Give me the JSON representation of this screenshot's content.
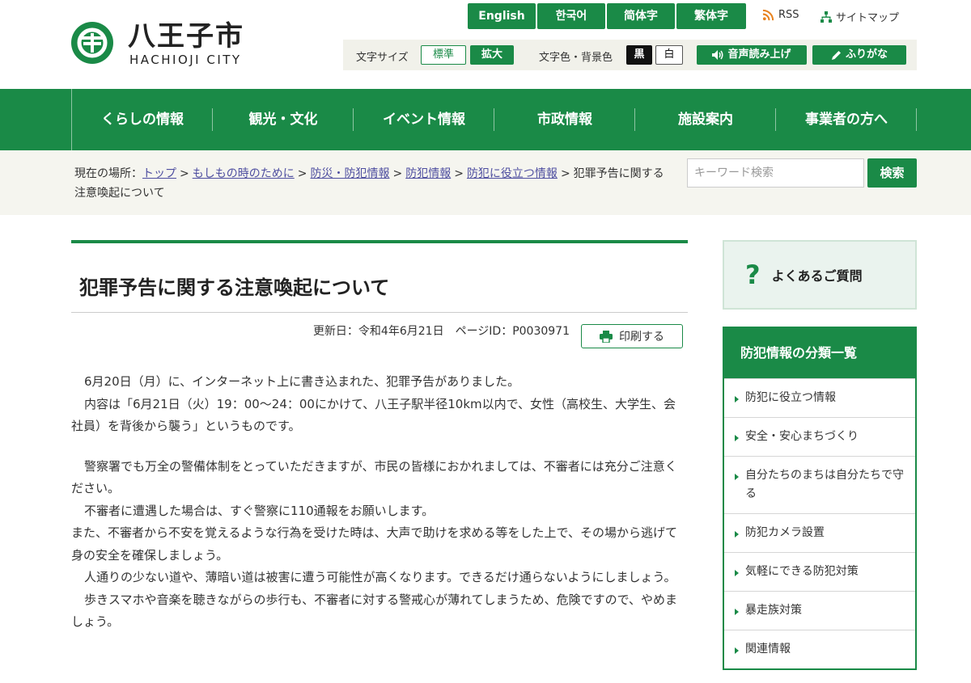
{
  "header": {
    "logo_jp": "八王子市",
    "logo_en": "HACHIOJI CITY",
    "languages": [
      "English",
      "한국어",
      "简体字",
      "繁体字"
    ],
    "rss": "RSS",
    "sitemap": "サイトマップ",
    "font_size_label": "文字サイズ",
    "font_standard": "標準",
    "font_large": "拡大",
    "color_label": "文字色・背景色",
    "color_black": "黒",
    "color_white": "白",
    "read_aloud": "音声読み上げ",
    "furigana": "ふりがな"
  },
  "nav": [
    "くらしの情報",
    "観光・文化",
    "イベント情報",
    "市政情報",
    "施設案内",
    "事業者の方へ"
  ],
  "breadcrumb": {
    "label": "現在の場所：",
    "links": [
      "トップ",
      "もしもの時のために",
      "防災・防犯情報",
      "防犯情報",
      "防犯に役立つ情報"
    ],
    "current": "犯罪予告に関する注意喚起について"
  },
  "search": {
    "placeholder": "キーワード検索",
    "button": "検索"
  },
  "article": {
    "title": "犯罪予告に関する注意喚起について",
    "meta": "更新日：令和4年6月21日　ページID：P0030971",
    "print": "印刷する",
    "p1": "6月20日（月）に、インターネット上に書き込まれた、犯罪予告がありました。",
    "p2": "内容は「6月21日（火）19：00〜24：00にかけて、八王子駅半径10km以内で、女性（高校生、大学生、会社員）を背後から襲う」というものです。",
    "p3": "警察署でも万全の警備体制をとっていただきますが、市民の皆様におかれましては、不審者には充分ご注意ください。",
    "p4": "不審者に遭遇した場合は、すぐ警察に110通報をお願いします。",
    "p5": "また、不審者から不安を覚えるような行為を受けた時は、大声で助けを求める等をした上で、その場から逃げて身の安全を確保しましょう。",
    "p6": "人通りの少ない道や、薄暗い道は被害に遭う可能性が高くなります。できるだけ通らないようにしましょう。",
    "p7": "歩きスマホや音楽を聴きながらの歩行も、不審者に対する警戒心が薄れてしまうため、危険ですので、やめましょう。"
  },
  "sidebar": {
    "faq": "よくあるご質問",
    "faq_mark": "?",
    "category_title": "防犯情報の分類一覧",
    "categories": [
      "防犯に役立つ情報",
      "安全・安心まちづくり",
      "自分たちのまちは自分たちで守る",
      "防犯カメラ設置",
      "気軽にできる防犯対策",
      "暴走族対策",
      "関連情報"
    ]
  },
  "colors": {
    "brand_green": "#1a8a47",
    "link": "#4e4ea0",
    "band": "#f5f5ef"
  },
  "icons": [
    "logo-mark-icon",
    "rss-icon",
    "sitemap-icon",
    "speaker-icon",
    "pencil-icon",
    "printer-icon",
    "chevron-right-icon"
  ]
}
